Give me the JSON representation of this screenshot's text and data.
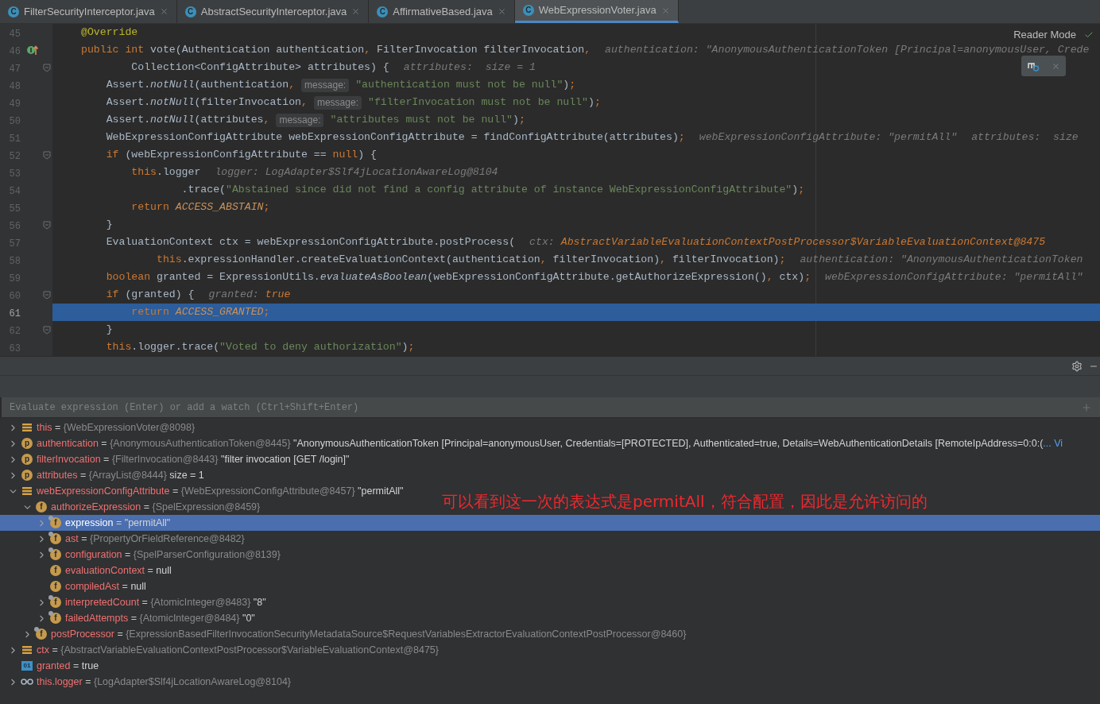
{
  "tabs": [
    {
      "icon_text": "C",
      "label": "FilterSecurityInterceptor.java",
      "selected": false
    },
    {
      "icon_text": "C",
      "label": "AbstractSecurityInterceptor.java",
      "selected": false
    },
    {
      "icon_text": "C",
      "label": "AffirmativeBased.java",
      "selected": false
    },
    {
      "icon_text": "C",
      "label": "WebExpressionVoter.java",
      "selected": true
    }
  ],
  "editor": {
    "reader_mode": "Reader Mode",
    "lines": [
      {
        "number": "45",
        "fold": false,
        "current": false,
        "overrides": false,
        "tokens": [
          {
            "kind": "ann",
            "text": "@Override"
          }
        ]
      },
      {
        "number": "46",
        "fold": false,
        "current": false,
        "overrides": true,
        "tokens": [
          {
            "kind": "kw",
            "text": "public int "
          },
          {
            "kind": "plain",
            "text": "vote(Authentication authentication"
          },
          {
            "kind": "kw",
            "text": ", "
          },
          {
            "kind": "plain",
            "text": "FilterInvocation filterInvocation"
          },
          {
            "kind": "kw",
            "text": ","
          },
          {
            "kind": "inlay",
            "text": "authentication: \"AnonymousAuthenticationToken [Principal=anonymousUser, Crede"
          }
        ]
      },
      {
        "number": "47",
        "fold": true,
        "current": false,
        "overrides": false,
        "tokens": [
          {
            "kind": "plain",
            "text": "        Collection<ConfigAttribute> attributes) {"
          },
          {
            "kind": "inlay",
            "text": "attributes:  size = 1"
          }
        ]
      },
      {
        "number": "48",
        "fold": false,
        "current": false,
        "overrides": false,
        "tokens": [
          {
            "kind": "plain",
            "text": "    Assert."
          },
          {
            "kind": "it",
            "text": "notNull"
          },
          {
            "kind": "plain",
            "text": "(authentication"
          },
          {
            "kind": "kw",
            "text": ","
          },
          {
            "kind": "chip",
            "text": "message:"
          },
          {
            "kind": "str",
            "text": "\"authentication must not be null\""
          },
          {
            "kind": "plain",
            "text": ")"
          },
          {
            "kind": "kw",
            "text": ";"
          }
        ]
      },
      {
        "number": "49",
        "fold": false,
        "current": false,
        "overrides": false,
        "tokens": [
          {
            "kind": "plain",
            "text": "    Assert."
          },
          {
            "kind": "it",
            "text": "notNull"
          },
          {
            "kind": "plain",
            "text": "(filterInvocation"
          },
          {
            "kind": "kw",
            "text": ","
          },
          {
            "kind": "chip",
            "text": "message:"
          },
          {
            "kind": "str",
            "text": "\"filterInvocation must not be null\""
          },
          {
            "kind": "plain",
            "text": ")"
          },
          {
            "kind": "kw",
            "text": ";"
          }
        ]
      },
      {
        "number": "50",
        "fold": false,
        "current": false,
        "overrides": false,
        "tokens": [
          {
            "kind": "plain",
            "text": "    Assert."
          },
          {
            "kind": "it",
            "text": "notNull"
          },
          {
            "kind": "plain",
            "text": "(attributes"
          },
          {
            "kind": "kw",
            "text": ","
          },
          {
            "kind": "chip",
            "text": "message:"
          },
          {
            "kind": "str",
            "text": "\"attributes must not be null\""
          },
          {
            "kind": "plain",
            "text": ")"
          },
          {
            "kind": "kw",
            "text": ";"
          }
        ]
      },
      {
        "number": "51",
        "fold": false,
        "current": false,
        "overrides": false,
        "tokens": [
          {
            "kind": "plain",
            "text": "    WebExpressionConfigAttribute webExpressionConfigAttribute = findConfigAttribute(attributes)"
          },
          {
            "kind": "kw",
            "text": ";"
          },
          {
            "kind": "inlay",
            "text": "webExpressionConfigAttribute: \"permitAll\""
          },
          {
            "kind": "inlay",
            "text": "attributes:  size"
          }
        ]
      },
      {
        "number": "52",
        "fold": true,
        "current": false,
        "overrides": false,
        "tokens": [
          {
            "kind": "kw",
            "text": "    if "
          },
          {
            "kind": "plain",
            "text": "(webExpressionConfigAttribute == "
          },
          {
            "kind": "kw",
            "text": "null"
          },
          {
            "kind": "plain",
            "text": ") {"
          }
        ]
      },
      {
        "number": "53",
        "fold": false,
        "current": false,
        "overrides": false,
        "tokens": [
          {
            "kind": "kw",
            "text": "        this"
          },
          {
            "kind": "plain",
            "text": ".logger"
          },
          {
            "kind": "inlay",
            "text": "logger: LogAdapter$Slf4jLocationAwareLog@8104"
          }
        ]
      },
      {
        "number": "54",
        "fold": false,
        "current": false,
        "overrides": false,
        "tokens": [
          {
            "kind": "plain",
            "text": "                .trace("
          },
          {
            "kind": "str",
            "text": "\"Abstained since did not find a config attribute of instance WebExpressionConfigAttribute\""
          },
          {
            "kind": "plain",
            "text": ")"
          },
          {
            "kind": "kw",
            "text": ";"
          }
        ]
      },
      {
        "number": "55",
        "fold": false,
        "current": false,
        "overrides": false,
        "tokens": [
          {
            "kind": "kw",
            "text": "        return "
          },
          {
            "kind": "const",
            "text": "ACCESS_ABSTAIN"
          },
          {
            "kind": "kw",
            "text": ";"
          }
        ]
      },
      {
        "number": "56",
        "fold": true,
        "current": false,
        "overrides": false,
        "tokens": [
          {
            "kind": "plain",
            "text": "    }"
          }
        ]
      },
      {
        "number": "57",
        "fold": false,
        "current": false,
        "overrides": false,
        "tokens": [
          {
            "kind": "plain",
            "text": "    EvaluationContext ctx = webExpressionConfigAttribute.postProcess("
          },
          {
            "kind": "inlay",
            "text": "ctx:"
          },
          {
            "kind": "inlay_hl",
            "text": "AbstractVariableEvaluationContextPostProcessor$VariableEvaluationContext@8475"
          }
        ]
      },
      {
        "number": "58",
        "fold": false,
        "current": false,
        "overrides": false,
        "tokens": [
          {
            "kind": "kw",
            "text": "            this"
          },
          {
            "kind": "plain",
            "text": ".expressionHandler.createEvaluationContext(authentication"
          },
          {
            "kind": "kw",
            "text": ", "
          },
          {
            "kind": "plain",
            "text": "filterInvocation)"
          },
          {
            "kind": "kw",
            "text": ", "
          },
          {
            "kind": "plain",
            "text": "filterInvocation)"
          },
          {
            "kind": "kw",
            "text": ";"
          },
          {
            "kind": "inlay",
            "text": "authentication: \"AnonymousAuthenticationToken"
          }
        ]
      },
      {
        "number": "59",
        "fold": false,
        "current": false,
        "overrides": false,
        "tokens": [
          {
            "kind": "kw",
            "text": "    boolean "
          },
          {
            "kind": "plain",
            "text": "granted = ExpressionUtils."
          },
          {
            "kind": "it",
            "text": "evaluateAsBoolean"
          },
          {
            "kind": "plain",
            "text": "(webExpressionConfigAttribute.getAuthorizeExpression()"
          },
          {
            "kind": "kw",
            "text": ", "
          },
          {
            "kind": "plain",
            "text": "ctx)"
          },
          {
            "kind": "kw",
            "text": ";"
          },
          {
            "kind": "inlay",
            "text": "webExpressionConfigAttribute: \"permitAll\""
          }
        ]
      },
      {
        "number": "60",
        "fold": true,
        "current": false,
        "overrides": false,
        "tokens": [
          {
            "kind": "kw",
            "text": "    if "
          },
          {
            "kind": "plain",
            "text": "(granted) {"
          },
          {
            "kind": "inlay",
            "text": "granted:"
          },
          {
            "kind": "inlay_hl",
            "text": "true"
          }
        ]
      },
      {
        "number": "61",
        "fold": false,
        "current": true,
        "overrides": false,
        "tokens": [
          {
            "kind": "kw",
            "text": "        return "
          },
          {
            "kind": "const",
            "text": "ACCESS_GRANTED"
          },
          {
            "kind": "kw",
            "text": ";"
          }
        ]
      },
      {
        "number": "62",
        "fold": true,
        "current": false,
        "overrides": false,
        "tokens": [
          {
            "kind": "plain",
            "text": "    }"
          }
        ]
      },
      {
        "number": "63",
        "fold": false,
        "current": false,
        "overrides": false,
        "tokens": [
          {
            "kind": "kw",
            "text": "    this"
          },
          {
            "kind": "plain",
            "text": ".logger.trace("
          },
          {
            "kind": "str",
            "text": "\"Voted to deny authorization\""
          },
          {
            "kind": "plain",
            "text": ")"
          },
          {
            "kind": "kw",
            "text": ";"
          }
        ]
      }
    ]
  },
  "debugger": {
    "evaluate_placeholder": "Evaluate expression (Enter) or add a watch (Ctrl+Shift+Enter)",
    "annotation": "可以看到这一次的表达式是permitAll，符合配置，因此是允许访问的",
    "variables": [
      {
        "kind": "object",
        "name": "this",
        "op": "=",
        "ref": "{WebExpressionVoter@8098}",
        "has_children": true,
        "expanded": false,
        "selected": false
      },
      {
        "kind": "letter",
        "badge": "p",
        "name": "authentication",
        "op": "=",
        "ref": "{AnonymousAuthenticationToken@8445}",
        "value": "\"AnonymousAuthenticationToken [Principal=anonymousUser, Credentials=[PROTECTED], Authenticated=true, Details=WebAuthenticationDetails [RemoteIpAddress=0:0:(",
        "link": "... Vi",
        "has_children": true,
        "expanded": false,
        "selected": false
      },
      {
        "kind": "letter",
        "badge": "p",
        "name": "filterInvocation",
        "op": "=",
        "ref": "{FilterInvocation@8443}",
        "value": "\"filter invocation [GET /login]\"",
        "has_children": true,
        "expanded": false,
        "selected": false
      },
      {
        "kind": "letter",
        "badge": "p",
        "name": "attributes",
        "op": "=",
        "ref": "{ArrayList@8444}",
        "value": "size = 1",
        "has_children": true,
        "expanded": false,
        "selected": false
      },
      {
        "kind": "object",
        "name": "webExpressionConfigAttribute",
        "op": "=",
        "ref": "{WebExpressionConfigAttribute@8457}",
        "value": "\"permitAll\"",
        "has_children": true,
        "expanded": true,
        "selected": false,
        "children": [
          {
            "kind": "letter",
            "badge": "f",
            "name": "authorizeExpression",
            "op": "=",
            "ref": "{SpelExpression@8459}",
            "has_children": true,
            "expanded": true,
            "selected": false,
            "children": [
              {
                "kind": "letter_final",
                "badge": "f",
                "name": "expression",
                "op": "=",
                "value": "\"permitAll\"",
                "has_children": true,
                "expanded": false,
                "selected": true
              },
              {
                "kind": "letter_final",
                "badge": "f",
                "name": "ast",
                "op": "=",
                "ref": "{PropertyOrFieldReference@8482}",
                "has_children": true,
                "expanded": false,
                "selected": false
              },
              {
                "kind": "letter_final",
                "badge": "f",
                "name": "configuration",
                "op": "=",
                "ref": "{SpelParserConfiguration@8139}",
                "has_children": true,
                "expanded": false,
                "selected": false
              },
              {
                "kind": "letter",
                "badge": "f",
                "name": "evaluationContext",
                "op": "=",
                "value": "null",
                "has_children": false,
                "selected": false
              },
              {
                "kind": "letter",
                "badge": "f",
                "name": "compiledAst",
                "op": "=",
                "value": "null",
                "has_children": false,
                "selected": false
              },
              {
                "kind": "letter_final",
                "badge": "f",
                "name": "interpretedCount",
                "op": "=",
                "ref": "{AtomicInteger@8483}",
                "value": "\"8\"",
                "has_children": true,
                "expanded": false,
                "selected": false
              },
              {
                "kind": "letter_final",
                "badge": "f",
                "name": "failedAttempts",
                "op": "=",
                "ref": "{AtomicInteger@8484}",
                "value": "\"0\"",
                "has_children": true,
                "expanded": false,
                "selected": false
              }
            ]
          },
          {
            "kind": "letter_final",
            "badge": "f",
            "name": "postProcessor",
            "op": "=",
            "ref": "{ExpressionBasedFilterInvocationSecurityMetadataSource$RequestVariablesExtractorEvaluationContextPostProcessor@8460}",
            "has_children": true,
            "expanded": false,
            "selected": false
          }
        ]
      },
      {
        "kind": "object",
        "name": "ctx",
        "op": "=",
        "ref": "{AbstractVariableEvaluationContextPostProcessor$VariableEvaluationContext@8475}",
        "has_children": true,
        "expanded": false,
        "selected": false
      },
      {
        "kind": "primitive",
        "badge": "01",
        "name": "granted",
        "op": "=",
        "value": "true",
        "has_children": false,
        "selected": false
      },
      {
        "kind": "watch",
        "name": "this.logger",
        "op": "=",
        "ref": "{LogAdapter$Slf4jLocationAwareLog@8104}",
        "has_children": true,
        "expanded": false,
        "selected": false
      }
    ]
  }
}
